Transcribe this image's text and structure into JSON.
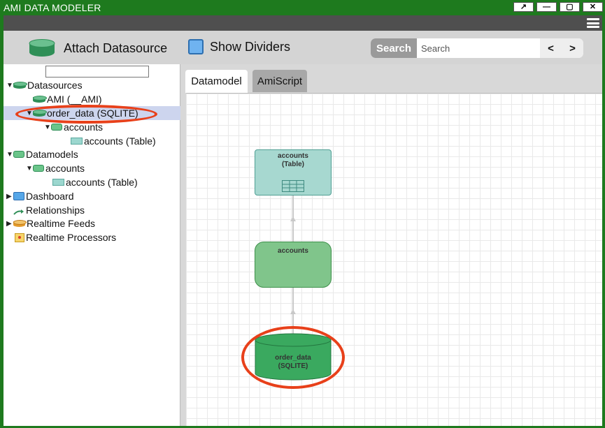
{
  "window": {
    "title": "AMI DATA MODELER",
    "buttons": [
      "↗",
      "—",
      "▢",
      "✕"
    ]
  },
  "toolbar": {
    "attach_label": "Attach Datasource",
    "dividers_label": "Show Dividers",
    "search_button": "Search",
    "search_placeholder": "Search",
    "prev_label": "<",
    "next_label": ">"
  },
  "tree": {
    "filter_value": "",
    "items": [
      {
        "label": "Datasources",
        "icon": "datasource-icon",
        "expanded": true
      },
      {
        "label": "AMI (__AMI)",
        "icon": "datasource-icon"
      },
      {
        "label": "order_data (SQLITE)",
        "icon": "datasource-icon",
        "expanded": true,
        "selected": true
      },
      {
        "label": "accounts",
        "icon": "datamodel-icon",
        "expanded": true
      },
      {
        "label": "accounts (Table)",
        "icon": "table-icon"
      },
      {
        "label": "Datamodels",
        "icon": "datamodel-icon",
        "expanded": true
      },
      {
        "label": "accounts",
        "icon": "datamodel-icon",
        "expanded": true
      },
      {
        "label": "accounts (Table)",
        "icon": "table-icon"
      },
      {
        "label": "Dashboard",
        "icon": "dashboard-icon",
        "expanded": false
      },
      {
        "label": "Relationships",
        "icon": "relationship-icon"
      },
      {
        "label": "Realtime Feeds",
        "icon": "feed-icon",
        "expanded": false
      },
      {
        "label": "Realtime Processors",
        "icon": "processor-icon"
      }
    ]
  },
  "tabs": [
    {
      "label": "Datamodel",
      "active": true
    },
    {
      "label": "AmiScript",
      "active": false
    }
  ],
  "graph": {
    "table_node": {
      "line1": "accounts",
      "line2": "(Table)"
    },
    "datamodel_node": {
      "label": "accounts"
    },
    "datasource_node": {
      "line1": "order_data",
      "line2": "(SQLITE)"
    }
  },
  "colors": {
    "window_chrome": "#1e7a1e",
    "highlight_ring": "#e8401a",
    "selected_row": "#cdd5ee"
  }
}
